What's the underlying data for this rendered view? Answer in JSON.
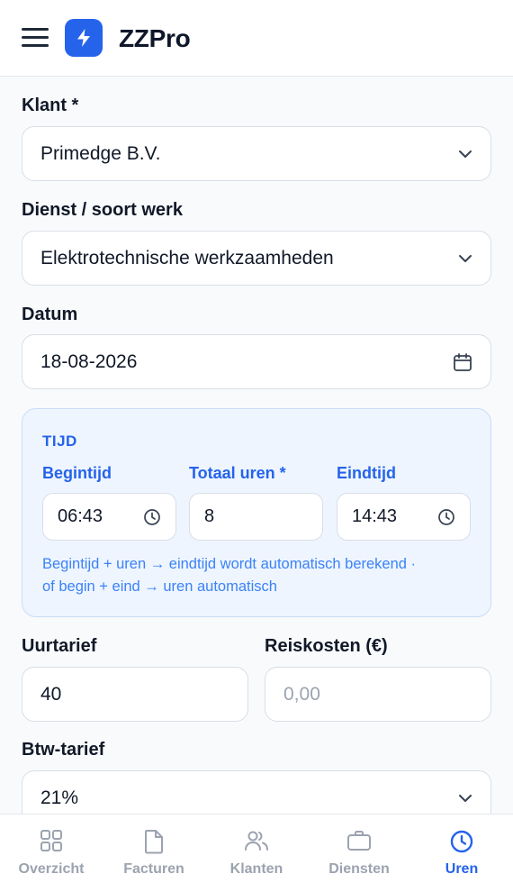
{
  "app": {
    "title": "ZZPro"
  },
  "form": {
    "klant": {
      "label": "Klant *",
      "value": "Primedge B.V."
    },
    "dienst": {
      "label": "Dienst / soort werk",
      "value": "Elektrotechnische werkzaamheden"
    },
    "datum": {
      "label": "Datum",
      "value": "18-08-2026"
    },
    "tijd": {
      "title": "TIJD",
      "begintijd": {
        "label": "Begintijd",
        "value": "06:43"
      },
      "totaal_uren": {
        "label": "Totaal uren *",
        "value": "8"
      },
      "eindtijd": {
        "label": "Eindtijd",
        "value": "14:43"
      },
      "hint_line1": "Begintijd + uren → eindtijd wordt automatisch berekend ·",
      "hint_line2": "of begin + eind → uren automatisch"
    },
    "uurtarief": {
      "label": "Uurtarief",
      "value": "40"
    },
    "reiskosten": {
      "label": "Reiskosten (€)",
      "placeholder": "0,00"
    },
    "btw": {
      "label": "Btw-tarief",
      "value": "21%"
    }
  },
  "nav": {
    "items": [
      {
        "label": "Overzicht",
        "icon": "grid-icon"
      },
      {
        "label": "Facturen",
        "icon": "document-icon"
      },
      {
        "label": "Klanten",
        "icon": "users-icon"
      },
      {
        "label": "Diensten",
        "icon": "briefcase-icon"
      },
      {
        "label": "Uren",
        "icon": "clock-icon",
        "active": true
      }
    ]
  },
  "colors": {
    "accent": "#2563eb",
    "inactive": "#9ca3af",
    "panel": "#eef5ff"
  }
}
